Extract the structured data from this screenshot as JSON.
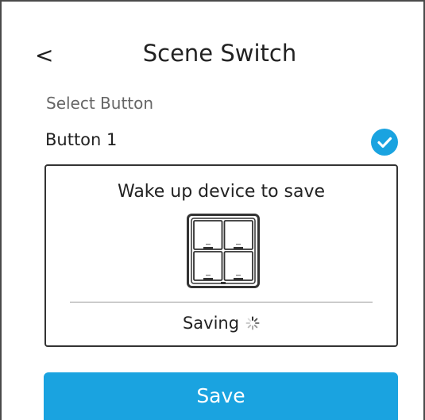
{
  "header": {
    "back_label": "<",
    "title": "Scene Switch"
  },
  "selection": {
    "label": "Select Button",
    "button_name": "Button 1",
    "selected": true,
    "check_icon": "check-circle-icon"
  },
  "card": {
    "title": "Wake up device to save",
    "device_icon": "four-gang-switch-icon",
    "status": "Saving",
    "status_icon": "loading-spinner-icon"
  },
  "footer": {
    "save_label": "Save"
  },
  "colors": {
    "accent": "#1aa3e0",
    "text": "#222222",
    "muted": "#666666"
  }
}
